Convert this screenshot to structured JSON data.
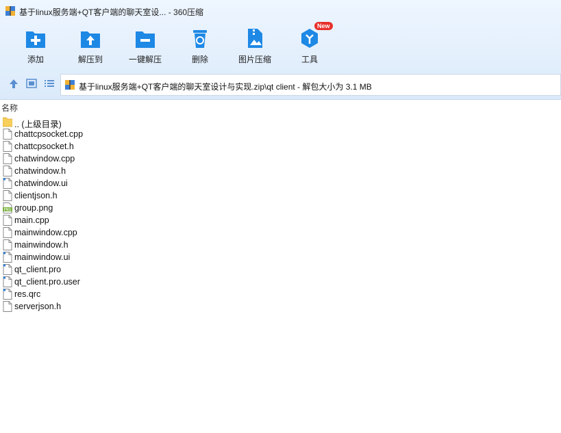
{
  "window": {
    "title": "基于linux服务端+QT客户端的聊天室设... - 360压缩"
  },
  "toolbar": {
    "items": [
      {
        "label": "添加",
        "icon": "add-icon"
      },
      {
        "label": "解压到",
        "icon": "extract-to-icon"
      },
      {
        "label": "一键解压",
        "icon": "quick-extract-icon"
      },
      {
        "label": "删除",
        "icon": "delete-icon"
      },
      {
        "label": "图片压缩",
        "icon": "image-compress-icon"
      },
      {
        "label": "工具",
        "icon": "tools-icon",
        "badge": "New"
      }
    ]
  },
  "navbar": {
    "path": "基于linux服务端+QT客户端的聊天室设计与实现.zip\\qt client - 解包大小为 3.1 MB"
  },
  "list": {
    "column_name": "名称",
    "files": [
      {
        "name": ".. (上级目录)",
        "type": "folder"
      },
      {
        "name": "chattcpsocket.cpp",
        "type": "file"
      },
      {
        "name": "chattcpsocket.h",
        "type": "file"
      },
      {
        "name": "chatwindow.cpp",
        "type": "file"
      },
      {
        "name": "chatwindow.h",
        "type": "file"
      },
      {
        "name": "chatwindow.ui",
        "type": "file-blue"
      },
      {
        "name": "clientjson.h",
        "type": "file"
      },
      {
        "name": "group.png",
        "type": "png"
      },
      {
        "name": "main.cpp",
        "type": "file"
      },
      {
        "name": "mainwindow.cpp",
        "type": "file"
      },
      {
        "name": "mainwindow.h",
        "type": "file"
      },
      {
        "name": "mainwindow.ui",
        "type": "file-blue"
      },
      {
        "name": "qt_client.pro",
        "type": "file-blue"
      },
      {
        "name": "qt_client.pro.user",
        "type": "file-blue"
      },
      {
        "name": "res.qrc",
        "type": "file-blue"
      },
      {
        "name": "serverjson.h",
        "type": "file"
      }
    ]
  },
  "colors": {
    "accent": "#1e88e5",
    "badge": "#e8302b"
  }
}
